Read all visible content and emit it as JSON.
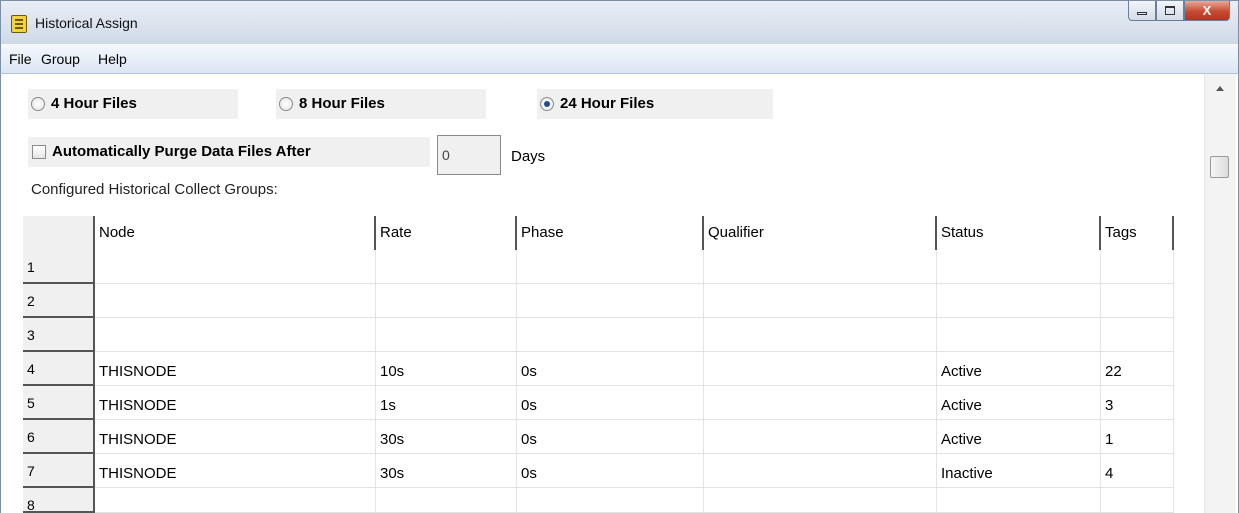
{
  "window": {
    "title": "Historical Assign",
    "close_glyph": "X"
  },
  "menu": [
    "File",
    "Group",
    "Help"
  ],
  "file_options": [
    {
      "label": "4 Hour Files",
      "checked": false
    },
    {
      "label": "8 Hour Files",
      "checked": false
    },
    {
      "label": "24 Hour Files",
      "checked": true
    }
  ],
  "purge": {
    "label": "Automatically Purge Data Files After",
    "checked": false,
    "value": "0",
    "unit": "Days"
  },
  "groups_label": "Configured Historical Collect Groups:",
  "table": {
    "columns": [
      "Node",
      "Rate",
      "Phase",
      "Qualifier",
      "Status",
      "Tags"
    ],
    "rows": [
      {
        "num": "1",
        "node": "",
        "rate": "",
        "phase": "",
        "qualifier": "",
        "status": "",
        "tags": ""
      },
      {
        "num": "2",
        "node": "",
        "rate": "",
        "phase": "",
        "qualifier": "",
        "status": "",
        "tags": ""
      },
      {
        "num": "3",
        "node": "",
        "rate": "",
        "phase": "",
        "qualifier": "",
        "status": "",
        "tags": ""
      },
      {
        "num": "4",
        "node": "THISNODE",
        "rate": "10s",
        "phase": "0s",
        "qualifier": "",
        "status": "Active",
        "tags": "22"
      },
      {
        "num": "5",
        "node": "THISNODE",
        "rate": "1s",
        "phase": "0s",
        "qualifier": "",
        "status": "Active",
        "tags": "3"
      },
      {
        "num": "6",
        "node": "THISNODE",
        "rate": "30s",
        "phase": "0s",
        "qualifier": "",
        "status": "Active",
        "tags": "1"
      },
      {
        "num": "7",
        "node": "THISNODE",
        "rate": "30s",
        "phase": "0s",
        "qualifier": "",
        "status": "Inactive",
        "tags": "4"
      },
      {
        "num": "8",
        "node": "",
        "rate": "",
        "phase": "",
        "qualifier": "",
        "status": "",
        "tags": ""
      }
    ]
  },
  "icons": {
    "app": "historical-assign-app-icon",
    "minimize": "minimize-icon",
    "maximize": "maximize-icon",
    "close": "close-icon",
    "scroll_up": "scroll-up-arrow-icon"
  }
}
